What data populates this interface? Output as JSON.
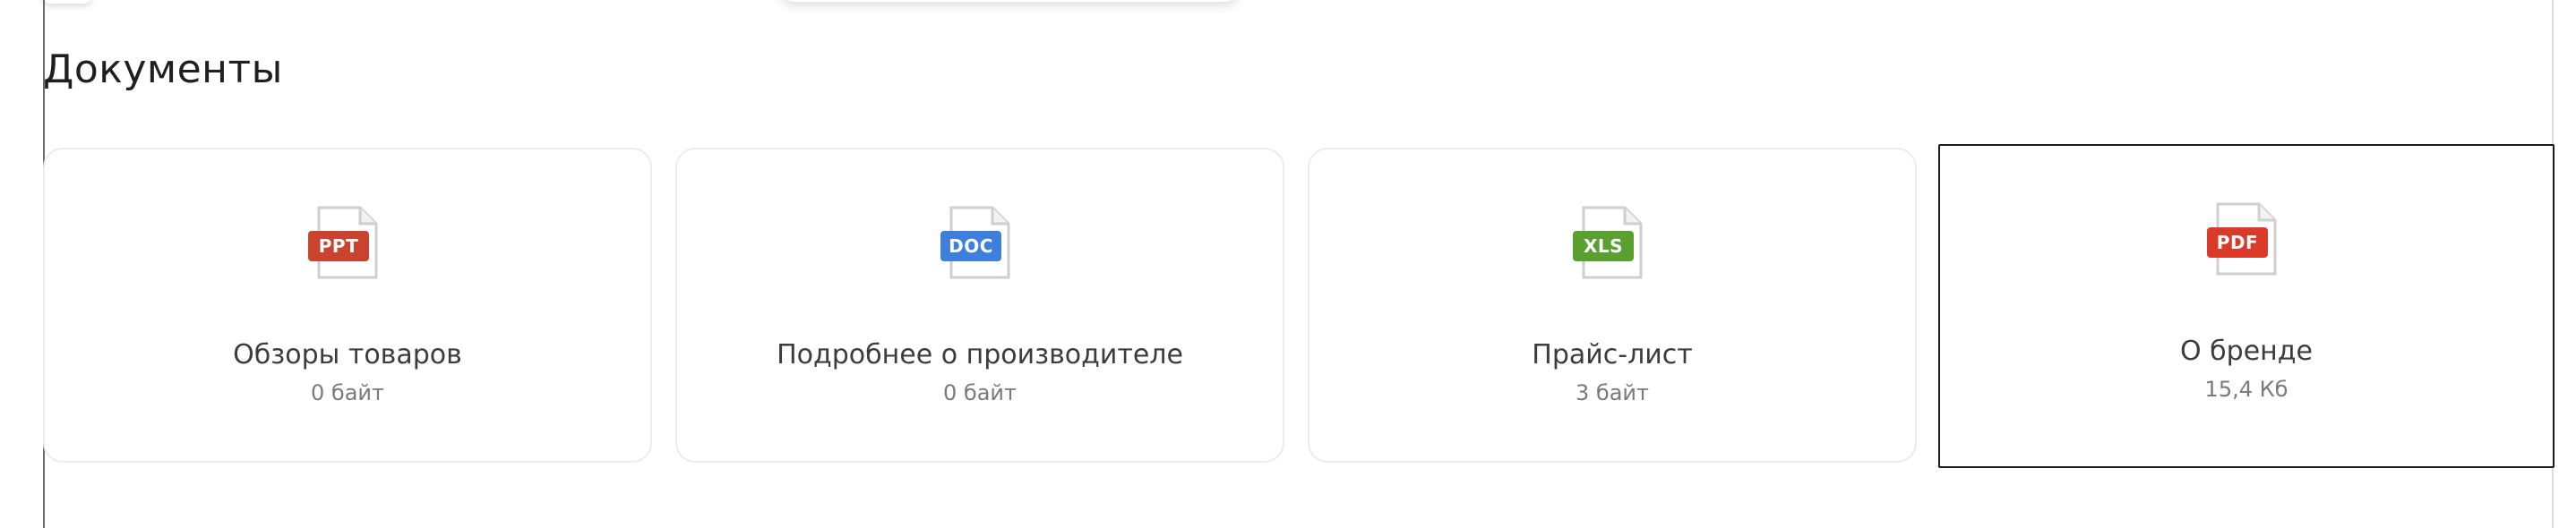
{
  "section": {
    "title": "Документы"
  },
  "documents": [
    {
      "badge": "PPT",
      "badge_color": "#c9432f",
      "icon": "file-ppt-icon",
      "title": "Обзоры товаров",
      "size": "0 байт"
    },
    {
      "badge": "DOC",
      "badge_color": "#3f7fdc",
      "icon": "file-doc-icon",
      "title": "Подробнее о производителе",
      "size": "0 байт"
    },
    {
      "badge": "XLS",
      "badge_color": "#5aa031",
      "icon": "file-xls-icon",
      "title": "Прайс-лист",
      "size": "3 байт"
    },
    {
      "badge": "PDF",
      "badge_color": "#d93a2a",
      "icon": "file-pdf-icon",
      "title": "О бренде",
      "size": "15,4 Кб"
    }
  ],
  "colors": {
    "card_border": "#ececec",
    "focused_border": "#1a1a1a",
    "title_text": "#3c3c3c",
    "size_text": "#7a7a7a",
    "file_outline": "#cfcfcf"
  }
}
